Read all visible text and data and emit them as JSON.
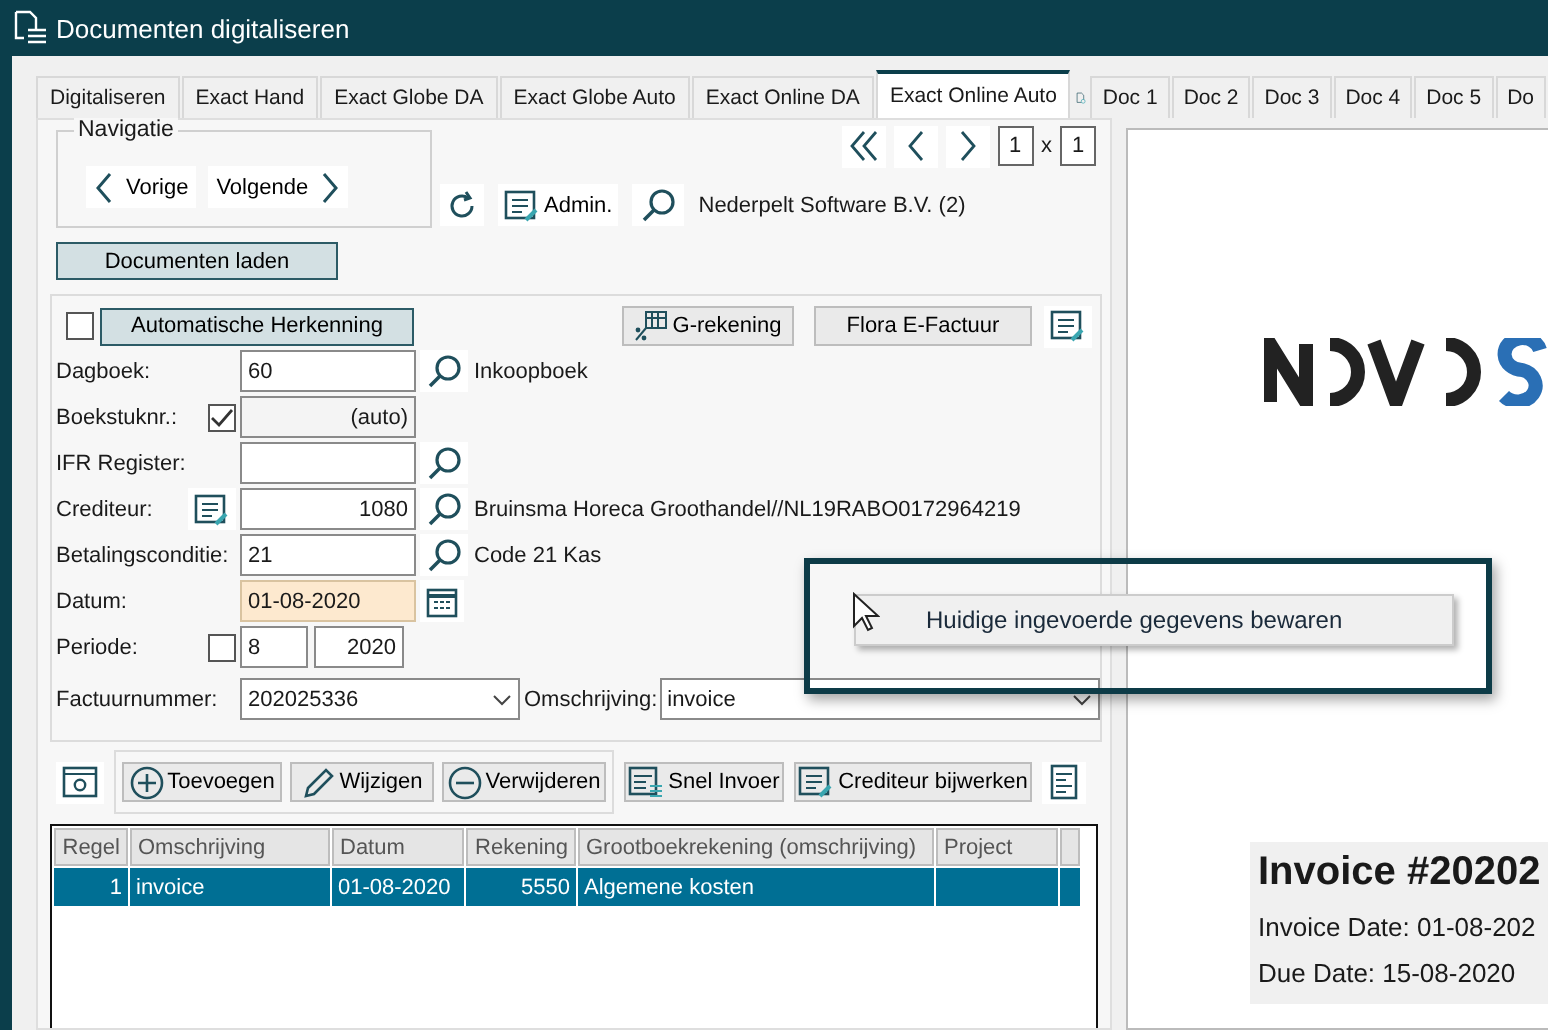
{
  "window": {
    "title": "Documenten digitaliseren"
  },
  "tabs": [
    {
      "label": "Digitaliseren",
      "selected": false
    },
    {
      "label": "Exact Hand",
      "selected": false
    },
    {
      "label": "Exact Globe DA",
      "selected": false
    },
    {
      "label": "Exact Globe Auto",
      "selected": false
    },
    {
      "label": "Exact Online DA",
      "selected": false
    },
    {
      "label": "Exact Online Auto",
      "selected": true
    }
  ],
  "doc_tabs": [
    "Doc 1",
    "Doc 2",
    "Doc 3",
    "Doc 4",
    "Doc 5",
    "Do"
  ],
  "navigation": {
    "title": "Navigatie",
    "previous": "Vorige",
    "next": "Volgende"
  },
  "pager": {
    "page": "1",
    "separator": "x",
    "total": "1"
  },
  "toolbar": {
    "admin": "Admin.",
    "company": "Nederpelt Software B.V. (2)"
  },
  "load_button": "Documenten laden",
  "form": {
    "auto_recognition": {
      "checked": false,
      "label": "Automatische Herkenning"
    },
    "buttons": [
      "G-rekening",
      "Flora E-Factuur"
    ],
    "fields": [
      {
        "kind": "lookup",
        "label": "Dagboek:",
        "value": "60",
        "description": "Inkoopboek"
      },
      {
        "kind": "auto",
        "label": "Boekstuknr.:",
        "checked": true,
        "value": "(auto)"
      },
      {
        "kind": "lookup",
        "label": "IFR Register:"
      },
      {
        "kind": "creditor",
        "label": "Crediteur:",
        "value": "1080",
        "description": "Bruinsma Horeca Groothandel//NL19RABO0172964219"
      },
      {
        "kind": "lookup",
        "label": "Betalingsconditie:",
        "value": "21",
        "description": "Code 21 Kas"
      },
      {
        "kind": "date",
        "label": "Datum:",
        "value": "01-08-2020"
      },
      {
        "kind": "period",
        "label": "Periode:",
        "checked": false,
        "value": "8",
        "year": "2020"
      }
    ],
    "invoice_number": {
      "label": "Factuurnummer:",
      "value": "202025336"
    },
    "description": {
      "label": "Omschrijving:",
      "value": "invoice"
    }
  },
  "grid_toolbar": {
    "buttons": [
      {
        "kind": "add",
        "label": "Toevoegen"
      },
      {
        "kind": "edit",
        "label": "Wijzigen"
      },
      {
        "kind": "remove",
        "label": "Verwijderen"
      }
    ],
    "actions": [
      {
        "kind": "quick",
        "label": "Snel Invoer"
      },
      {
        "kind": "creditor",
        "label": "Crediteur bijwerken"
      }
    ]
  },
  "table": {
    "columns": [
      "Regel",
      "Omschrijving",
      "Datum",
      "Rekening",
      "Grootboekrekening (omschrijving)",
      "Project"
    ],
    "rows": [
      {
        "selected": true,
        "cells": [
          "1",
          "invoice",
          "01-08-2020",
          "5550",
          "Algemene kosten"
        ]
      }
    ]
  },
  "context_menu": {
    "items": [
      "Huidige ingevoerde gegevens bewaren"
    ]
  },
  "preview": {
    "invoice_title": "Invoice #20202",
    "lines": [
      "Invoice Date: 01-08-202",
      "Due Date: 15-08-2020"
    ]
  }
}
